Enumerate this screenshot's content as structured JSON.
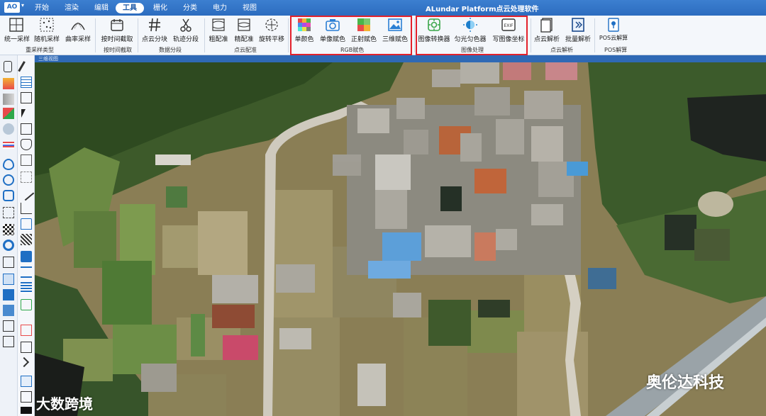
{
  "app": {
    "logo_text": "AO",
    "title": "ALundar Platform点云处理软件"
  },
  "menu": {
    "tabs": [
      "开始",
      "渲染",
      "编辑",
      "工具",
      "栅化",
      "分类",
      "电力",
      "视图"
    ],
    "active": "工具"
  },
  "ribbon": {
    "tools": [
      {
        "label": "统一采样",
        "icon": "grid-sample-icon"
      },
      {
        "label": "随机采样",
        "icon": "random-sample-icon"
      },
      {
        "label": "曲率采样",
        "icon": "curvature-sample-icon"
      },
      {
        "label": "按时间截取",
        "icon": "calendar-icon"
      },
      {
        "label": "点云分块",
        "icon": "hash-icon"
      },
      {
        "label": "轨迹分段",
        "icon": "scissors-icon"
      },
      {
        "label": "粗配准",
        "icon": "coarse-register-icon"
      },
      {
        "label": "精配准",
        "icon": "fine-register-icon"
      },
      {
        "label": "旋转平移",
        "icon": "rotate-icon"
      },
      {
        "label": "单颜色",
        "icon": "palette-icon"
      },
      {
        "label": "单像赋色",
        "icon": "camera-icon"
      },
      {
        "label": "正射赋色",
        "icon": "ortho-icon"
      },
      {
        "label": "三维赋色",
        "icon": "image-icon"
      },
      {
        "label": "图像转换器",
        "icon": "image-convert-icon"
      },
      {
        "label": "匀光匀色器",
        "icon": "brightness-icon"
      },
      {
        "label": "写图像坐标",
        "icon": "exif-icon"
      },
      {
        "label": "点云解析",
        "icon": "document-icon"
      },
      {
        "label": "批量解析",
        "icon": "batch-icon"
      },
      {
        "label": "POS云解算",
        "icon": "pos-solve-icon"
      }
    ],
    "groups": [
      "重采样类型",
      "按时间截取",
      "数据分段",
      "点云配准",
      "RGB赋色",
      "图像处理",
      "点云解析",
      "POS解算"
    ],
    "exif_text": "EXIF",
    "pos_text": "POS云解算",
    "highlight_color": "#e3212b"
  },
  "view": {
    "title": "三维视图"
  },
  "watermarks": {
    "left": "大数跨境",
    "right": "奥伦达科技"
  }
}
